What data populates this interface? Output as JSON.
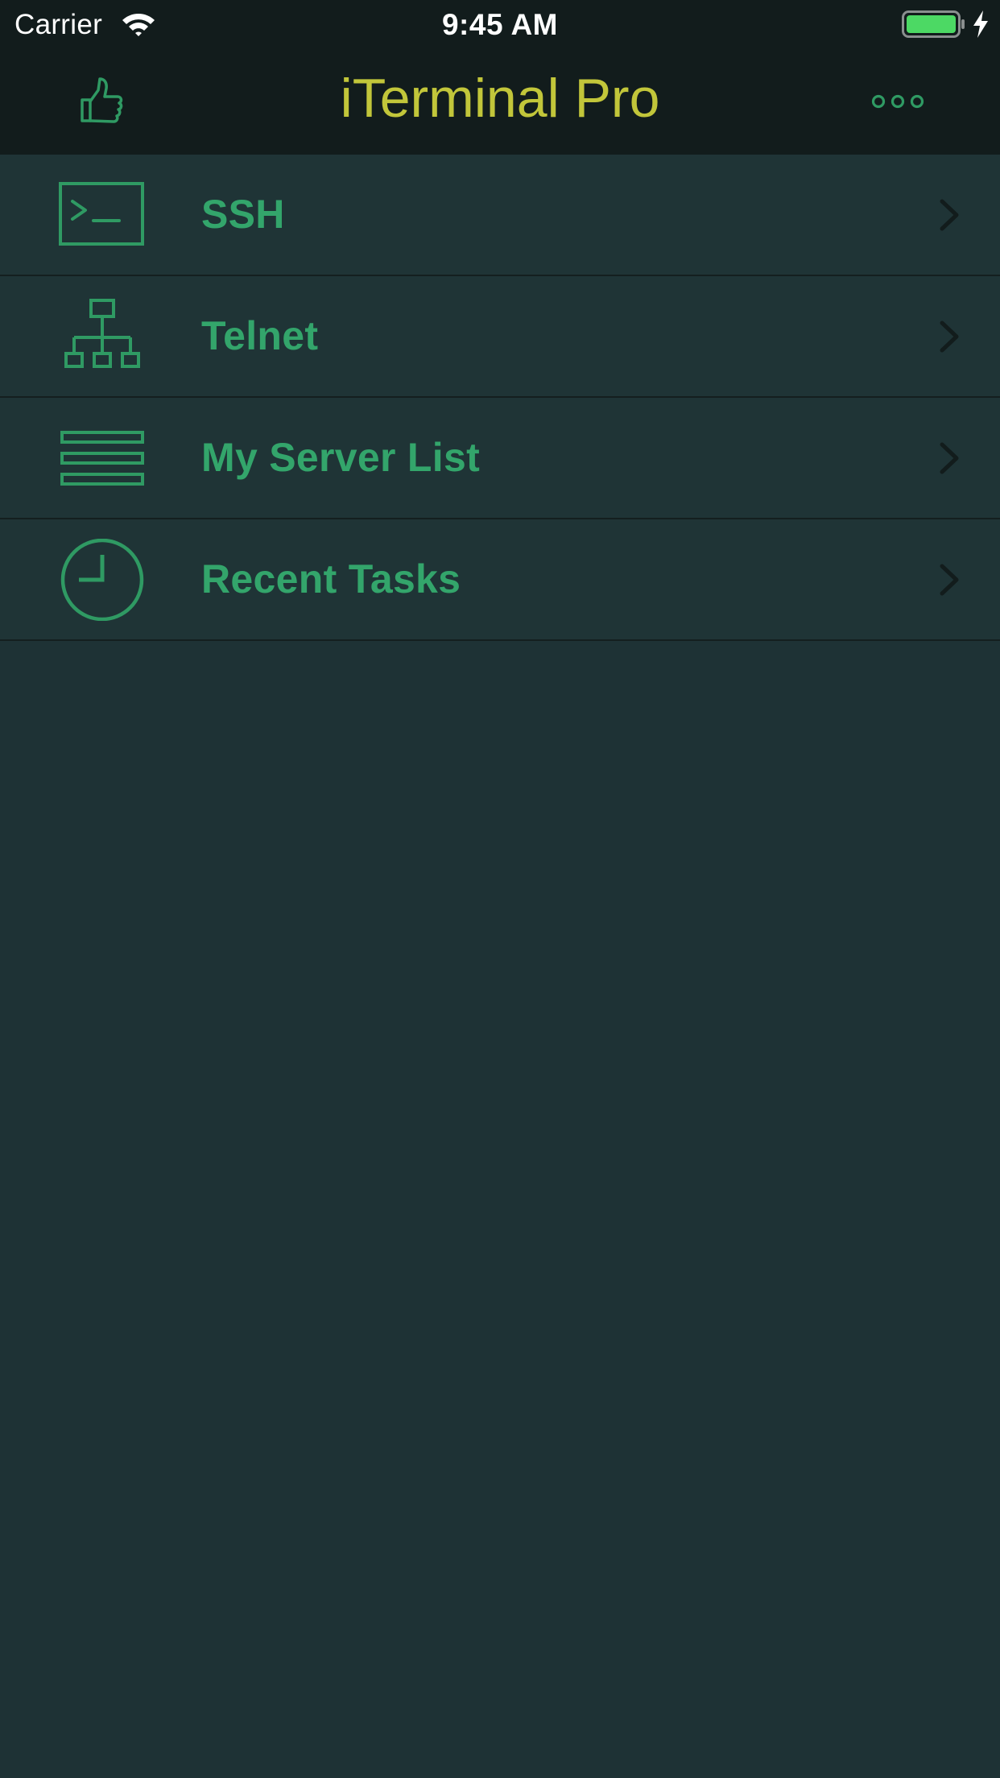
{
  "status_bar": {
    "carrier": "Carrier",
    "time": "9:45 AM"
  },
  "nav_bar": {
    "title": "iTerminal Pro",
    "left_icon": "thumbs-up-icon",
    "right_icon": "more-icon"
  },
  "menu": {
    "items": [
      {
        "label": "SSH",
        "icon": "terminal-icon"
      },
      {
        "label": "Telnet",
        "icon": "network-icon"
      },
      {
        "label": "My Server List",
        "icon": "server-list-icon"
      },
      {
        "label": "Recent Tasks",
        "icon": "clock-icon"
      }
    ]
  },
  "colors": {
    "background": "#1e3235",
    "top_bar": "#121c1c",
    "title": "#c2c63a",
    "accent_green": "#33a56b",
    "battery_fill": "#4cd964",
    "separator": "#141f1f",
    "chevron": "#121c1c"
  }
}
